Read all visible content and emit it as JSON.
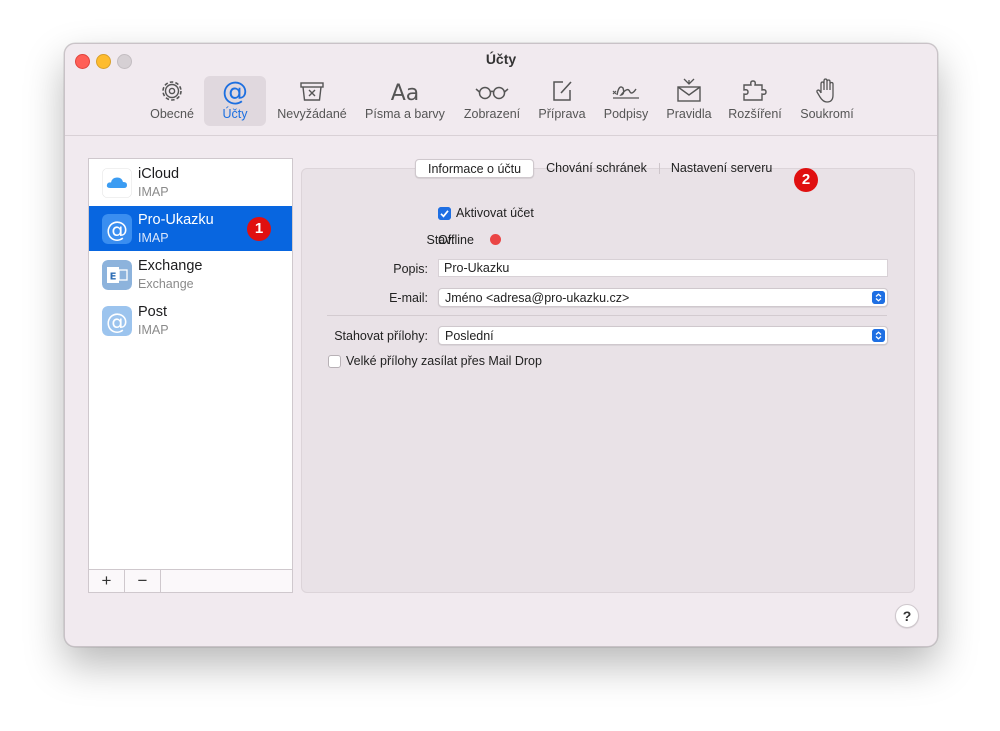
{
  "window": {
    "title": "Účty"
  },
  "toolbar": {
    "items": [
      {
        "label": "Obecné",
        "icon": "gear-icon"
      },
      {
        "label": "Účty",
        "icon": "at-sign-icon"
      },
      {
        "label": "Nevyžádané",
        "icon": "junk-bin-icon"
      },
      {
        "label": "Písma a barvy",
        "icon": "fonts-icon",
        "glyph": "Aa"
      },
      {
        "label": "Zobrazení",
        "icon": "glasses-icon"
      },
      {
        "label": "Příprava",
        "icon": "compose-icon"
      },
      {
        "label": "Podpisy",
        "icon": "signature-icon"
      },
      {
        "label": "Pravidla",
        "icon": "rules-envelope-icon"
      },
      {
        "label": "Rozšíření",
        "icon": "puzzle-icon"
      },
      {
        "label": "Soukromí",
        "icon": "hand-icon"
      }
    ],
    "active_index": 1
  },
  "accounts": [
    {
      "name": "iCloud",
      "type": "IMAP",
      "icon": "icloud-icon"
    },
    {
      "name": "Pro-Ukazku",
      "type": "IMAP",
      "icon": "at-sign-icon",
      "selected": true
    },
    {
      "name": "Exchange",
      "type": "Exchange",
      "icon": "exchange-icon"
    },
    {
      "name": "Post",
      "type": "IMAP",
      "icon": "at-sign-icon"
    }
  ],
  "sidebar_footer": {
    "add": "+",
    "remove": "−"
  },
  "badges": {
    "one": "1",
    "two": "2"
  },
  "tabs": [
    {
      "label": "Informace o účtu",
      "active": true
    },
    {
      "label": "Chování schránek"
    },
    {
      "label": "Nastavení serveru"
    }
  ],
  "form": {
    "enable_account": {
      "label": "Aktivovat účet",
      "checked": true
    },
    "status": {
      "label": "Stav:",
      "value": "Offline",
      "color": "#ea4545"
    },
    "description": {
      "label": "Popis:",
      "value": "Pro-Ukazku"
    },
    "email": {
      "label": "E-mail:",
      "value": "Jméno <adresa@pro-ukazku.cz>"
    },
    "download_attachments": {
      "label": "Stahovat přílohy:",
      "value": "Poslední"
    },
    "mail_drop": {
      "label": "Velké přílohy zasílat přes Mail Drop",
      "checked": false
    }
  },
  "help": {
    "label": "?"
  },
  "colors": {
    "accent": "#0866e0",
    "badge": "#e01010"
  }
}
